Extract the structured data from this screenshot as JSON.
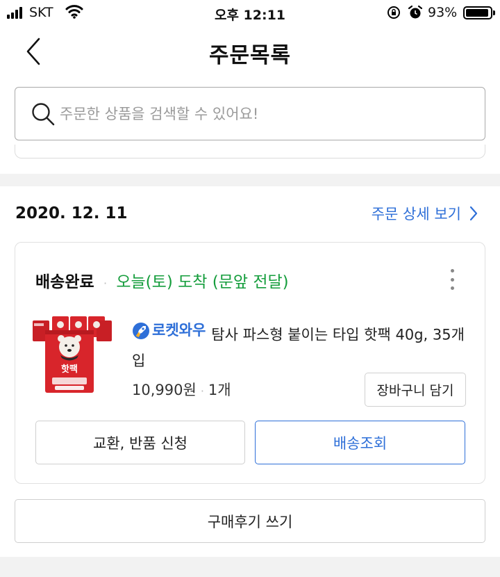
{
  "status_bar": {
    "carrier": "SKT",
    "time": "오후 12:11",
    "battery": "93%",
    "icons": [
      "signal-icon",
      "wifi-icon",
      "orientation-lock-icon",
      "alarm-icon",
      "battery-icon"
    ]
  },
  "header": {
    "title": "주문목록",
    "back_icon": "chevron-left-icon"
  },
  "search": {
    "placeholder": "주문한 상품을 검색할 수 있어요!",
    "value": "",
    "icon": "search-icon"
  },
  "order": {
    "date": "2020. 12. 11",
    "detail_link": "주문 상세 보기",
    "status": "배송완료",
    "separator": "·",
    "arrival": "오늘(토) 도착 (문앞 전달)",
    "product": {
      "badge": "로켓와우",
      "name": "탐사 파스형 붙이는 타입 핫팩 40g, 35개입",
      "price": "10,990원",
      "quantity": "1개",
      "image_text": "핫팩"
    },
    "cart_button": "장바구니 담기",
    "exchange_button": "교환, 반품 신청",
    "tracking_button": "배송조회",
    "review_button": "구매후기 쓰기"
  },
  "colors": {
    "accent_blue": "#2e6fd8",
    "arrival_green": "#159d3c",
    "product_red": "#d8252b"
  }
}
